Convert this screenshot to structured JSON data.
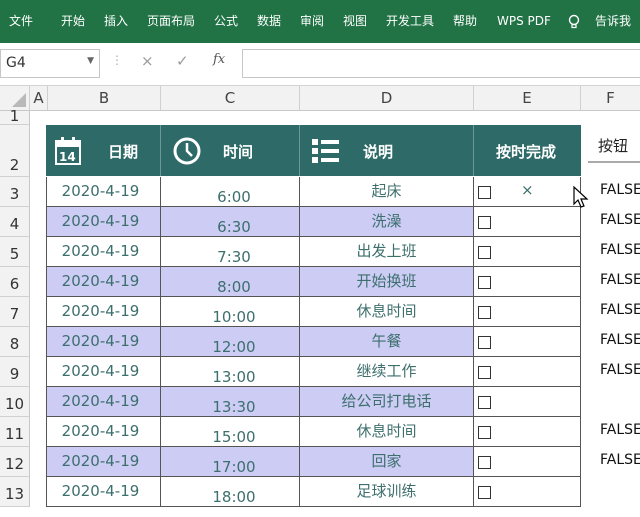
{
  "ribbon": {
    "menus": [
      "文件",
      "开始",
      "插入",
      "页面布局",
      "公式",
      "数据",
      "审阅",
      "视图",
      "开发工具",
      "帮助",
      "WPS PDF",
      "告诉我"
    ],
    "bg": "#217346"
  },
  "formula_bar": {
    "name_box": "G4",
    "cancel_glyph": "×",
    "enter_glyph": "✓",
    "fx_glyph": "fx",
    "formula": ""
  },
  "columns": [
    "A",
    "B",
    "C",
    "D",
    "E",
    "F"
  ],
  "rows": [
    "1",
    "2",
    "3",
    "4",
    "5",
    "6",
    "7",
    "8",
    "9",
    "10",
    "11",
    "12",
    "13"
  ],
  "table": {
    "headers": {
      "date": "日期",
      "time": "时间",
      "desc": "说明",
      "done": "按时完成"
    },
    "calendar_day": "14",
    "rows": [
      {
        "date": "2020-4-19",
        "time": "6:00",
        "desc": "起床",
        "checked": false,
        "mark": "×",
        "false_text": "FALSE"
      },
      {
        "date": "2020-4-19",
        "time": "6:30",
        "desc": "洗澡",
        "checked": false,
        "mark": "",
        "false_text": "FALSE"
      },
      {
        "date": "2020-4-19",
        "time": "7:30",
        "desc": "出发上班",
        "checked": false,
        "mark": "",
        "false_text": "FALSE"
      },
      {
        "date": "2020-4-19",
        "time": "8:00",
        "desc": "开始换班",
        "checked": false,
        "mark": "",
        "false_text": "FALSE"
      },
      {
        "date": "2020-4-19",
        "time": "10:00",
        "desc": "休息时间",
        "checked": false,
        "mark": "",
        "false_text": "FALSE"
      },
      {
        "date": "2020-4-19",
        "time": "12:00",
        "desc": "午餐",
        "checked": false,
        "mark": "",
        "false_text": "FALSE"
      },
      {
        "date": "2020-4-19",
        "time": "13:00",
        "desc": "继续工作",
        "checked": false,
        "mark": "",
        "false_text": "FALSE"
      },
      {
        "date": "2020-4-19",
        "time": "13:30",
        "desc": "给公司打电话",
        "checked": false,
        "mark": "",
        "false_text": ""
      },
      {
        "date": "2020-4-19",
        "time": "15:00",
        "desc": "休息时间",
        "checked": false,
        "mark": "",
        "false_text": "FALSE"
      },
      {
        "date": "2020-4-19",
        "time": "17:00",
        "desc": "回家",
        "checked": false,
        "mark": "",
        "false_text": "FALSE"
      },
      {
        "date": "2020-4-19",
        "time": "18:00",
        "desc": "足球训练",
        "checked": false,
        "mark": "",
        "false_text": ""
      }
    ],
    "band_color": "#ccccf5",
    "header_color": "#2e6b68",
    "text_color": "#3d6f6d"
  },
  "side_button": {
    "label": "按钮"
  }
}
